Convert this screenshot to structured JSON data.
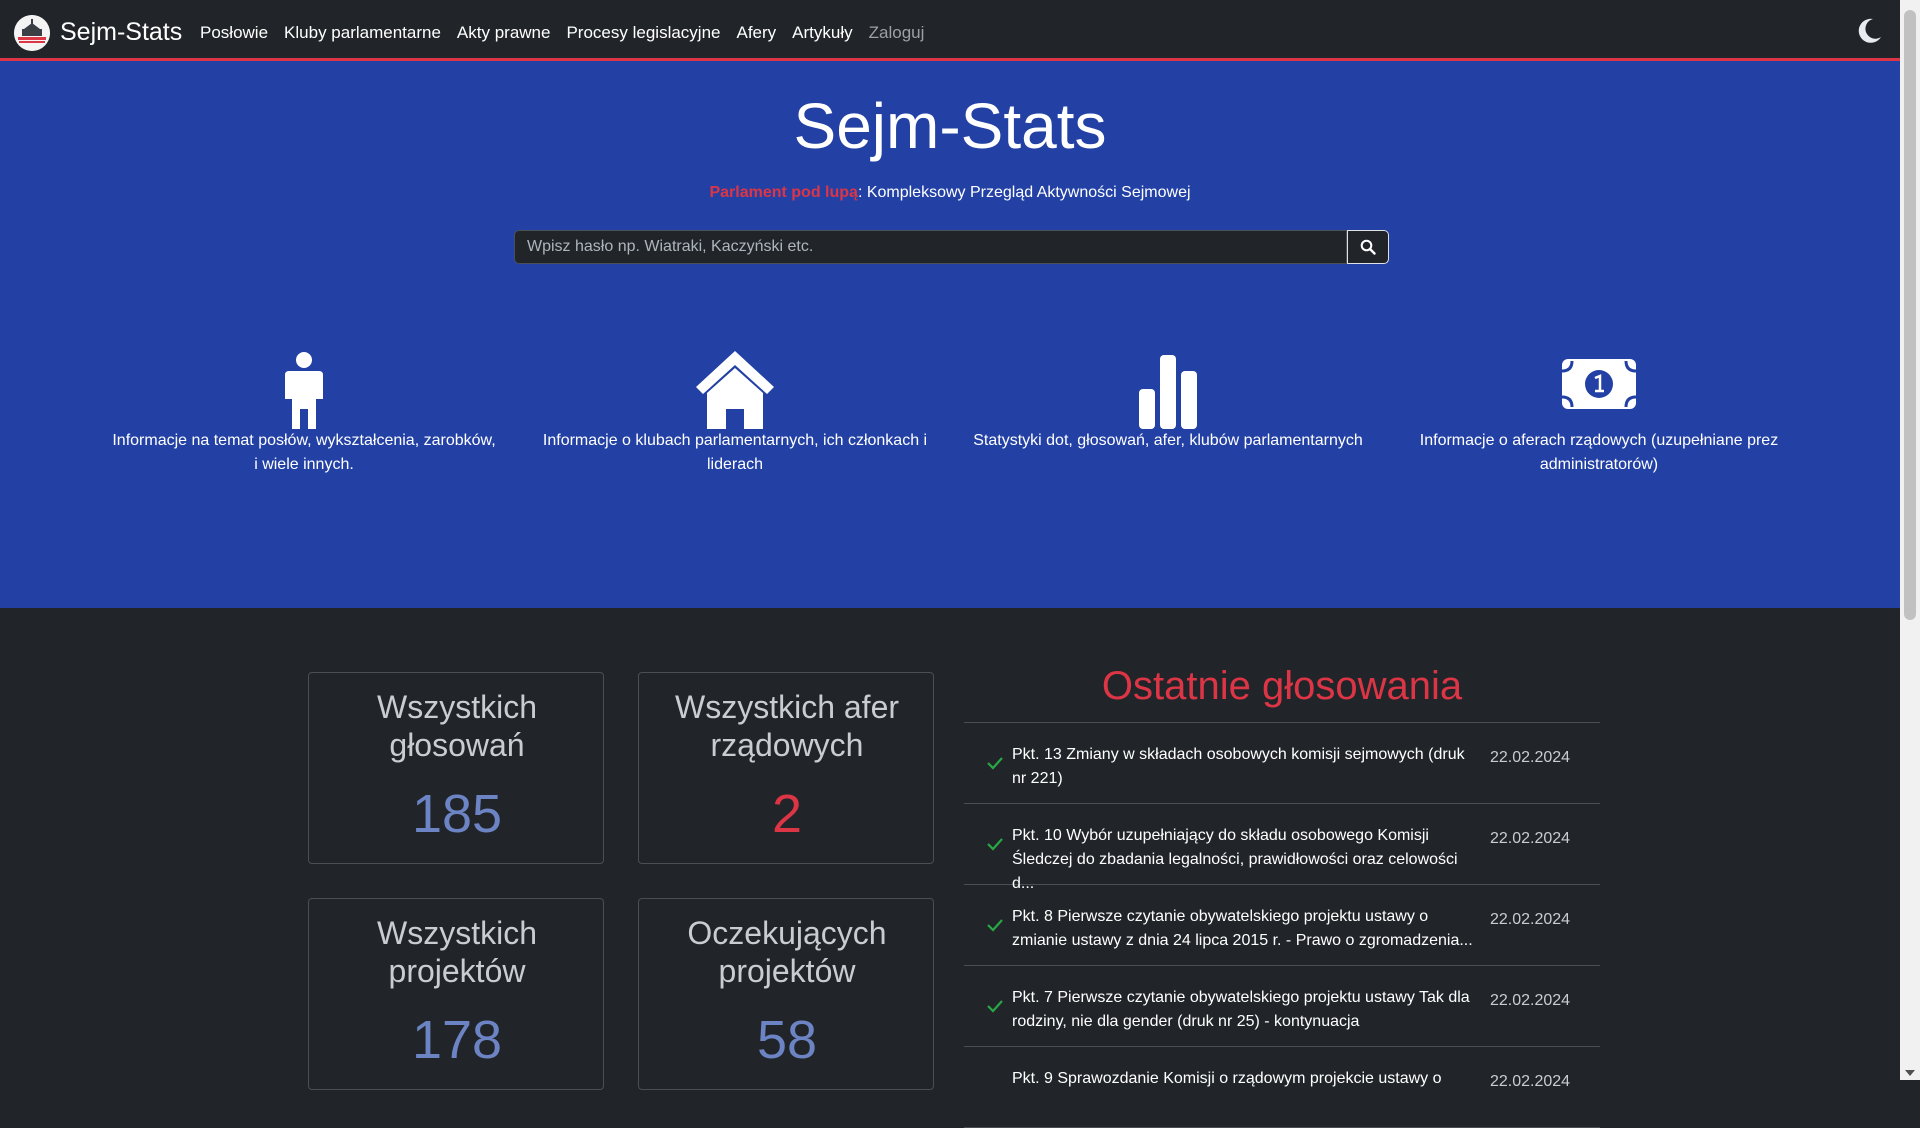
{
  "nav": {
    "brand": "Sejm-Stats",
    "links": [
      "Posłowie",
      "Kluby parlamentarne",
      "Akty prawne",
      "Procesy legislacyjne",
      "Afery",
      "Artykuły",
      "Zaloguj"
    ]
  },
  "hero": {
    "title": "Sejm-Stats",
    "subtitle_accent": "Parlament pod lupą",
    "subtitle_rest": ": Kompleksowy Przegląd Aktywności Sejmowej",
    "search_placeholder": "Wpisz hasło np. Wiatraki, Kaczyński etc.",
    "features": [
      {
        "icon": "person-icon",
        "text": "Informacje na temat posłów, wykształcenia, zarobków, i wiele innych."
      },
      {
        "icon": "house-icon",
        "text": "Informacje o klubach parlamentarnych, ich członkach i liderach"
      },
      {
        "icon": "chart-icon",
        "text": "Statystyki dot, głosowań, afer, klubów parlamentarnych"
      },
      {
        "icon": "money-bill-icon",
        "text": "Informacje o aferach rządowych (uzupełniane prez administratorów)"
      }
    ]
  },
  "stats": [
    {
      "title": "Wszystkich głosowań",
      "value": "185"
    },
    {
      "title": "Wszystkich afer rządowych",
      "value": "2"
    },
    {
      "title": "Wszystkich projektów",
      "value": "178"
    },
    {
      "title": "Oczekujących projektów",
      "value": "58"
    }
  ],
  "recent": {
    "title": "Ostatnie głosowania",
    "items": [
      {
        "text": "Pkt. 13 Zmiany w składach osobowych komisji sejmowych (druk nr 221)",
        "date": "22.02.2024"
      },
      {
        "text": "Pkt. 10 Wybór uzupełniający do składu osobowego Komisji Śledczej do zbadania legalności, prawidłowości oraz celowości d...",
        "date": "22.02.2024"
      },
      {
        "text": "Pkt. 8 Pierwsze czytanie obywatelskiego projektu ustawy o zmianie ustawy z dnia 24 lipca 2015 r. - Prawo o zgromadzenia...",
        "date": "22.02.2024"
      },
      {
        "text": "Pkt. 7 Pierwsze czytanie obywatelskiego projektu ustawy Tak dla rodziny, nie dla gender (druk nr 25) - kontynuacja",
        "date": "22.02.2024"
      },
      {
        "text": "Pkt. 9 Sprawozdanie Komisji o rządowym projekcie ustawy o",
        "date": "22.02.2024"
      }
    ]
  },
  "colors": {
    "accent": "#dc3545",
    "hero_bg": "#2341a5",
    "stat_value": "#6c84c4"
  }
}
